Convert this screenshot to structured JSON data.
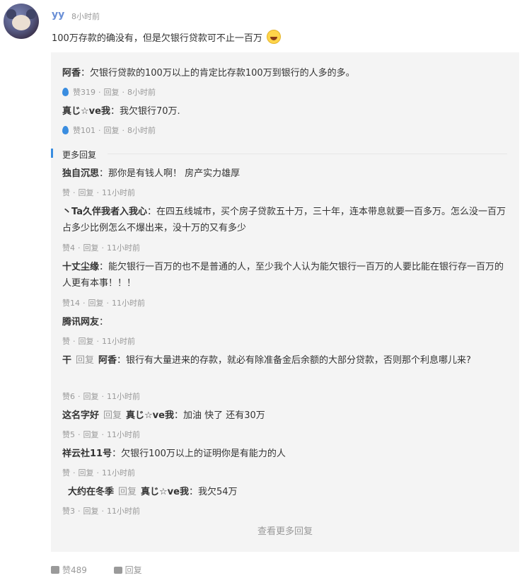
{
  "comment": {
    "username": "yy",
    "time": "8小时前",
    "content": "100万存款的确没有，但是欠银行贷款可不止一百万",
    "emoji": "laughing-with-tears-emoji"
  },
  "top_replies": [
    {
      "author": "阿香",
      "text": "：欠银行贷款的100万以上的肯定比存款100万到银行的人多的多。",
      "likes": "赞319",
      "reply": "回复",
      "time": "8小时前"
    },
    {
      "author": "真じ☆ve我",
      "text": "：我欠银行70万.",
      "likes": "赞101",
      "reply": "回复",
      "time": "8小时前"
    }
  ],
  "more_label": "更多回复",
  "more_replies": [
    {
      "author": "独自沉思",
      "text": "：那你是有钱人啊！ 房产实力雄厚",
      "likes": "赞",
      "reply": "回复",
      "time": "11小时前"
    },
    {
      "author": "丶Ta久伴我者入我心",
      "text": "：在四五线城市，买个房子贷款五十万，三十年，连本带息就要一百多万。怎么没一百万占多少比例怎么不爆出来，没十万的又有多少",
      "likes": "赞4",
      "reply": "回复",
      "time": "11小时前"
    },
    {
      "author": "十丈尘缘",
      "text": "：能欠银行一百万的也不是普通的人，至少我个人认为能欠银行一百万的人要比能在银行存一百万的人更有本事！！！",
      "likes": "赞14",
      "reply": "回复",
      "time": "11小时前"
    },
    {
      "author": "腾讯网友",
      "text": "：",
      "likes": "赞",
      "reply": "回复",
      "time": "11小时前"
    },
    {
      "author": "干",
      "reply_word": "回复",
      "target": "阿香",
      "text": "：银行有大量进来的存款，就必有除准备金后余额的大部分贷款，否则那个利息哪儿来?",
      "likes": "赞6",
      "reply": "回复",
      "time": "11小时前"
    },
    {
      "author": "这名字好",
      "reply_word": "回复",
      "target": "真じ☆ve我",
      "text": "：加油 快了 还有30万",
      "likes": "赞5",
      "reply": "回复",
      "time": "11小时前"
    },
    {
      "author": "祥云社11号",
      "text": "：欠银行100万以上的证明你是有能力的人",
      "likes": "赞",
      "reply": "回复",
      "time": "11小时前"
    },
    {
      "author": "大约在冬季",
      "reply_word": "回复",
      "target": "真じ☆ve我",
      "text": "：我欠54万",
      "likes": "赞3",
      "reply": "回复",
      "time": "11小时前"
    }
  ],
  "view_more": "查看更多回复",
  "footer": {
    "likes": "赞489",
    "reply": "回复"
  }
}
